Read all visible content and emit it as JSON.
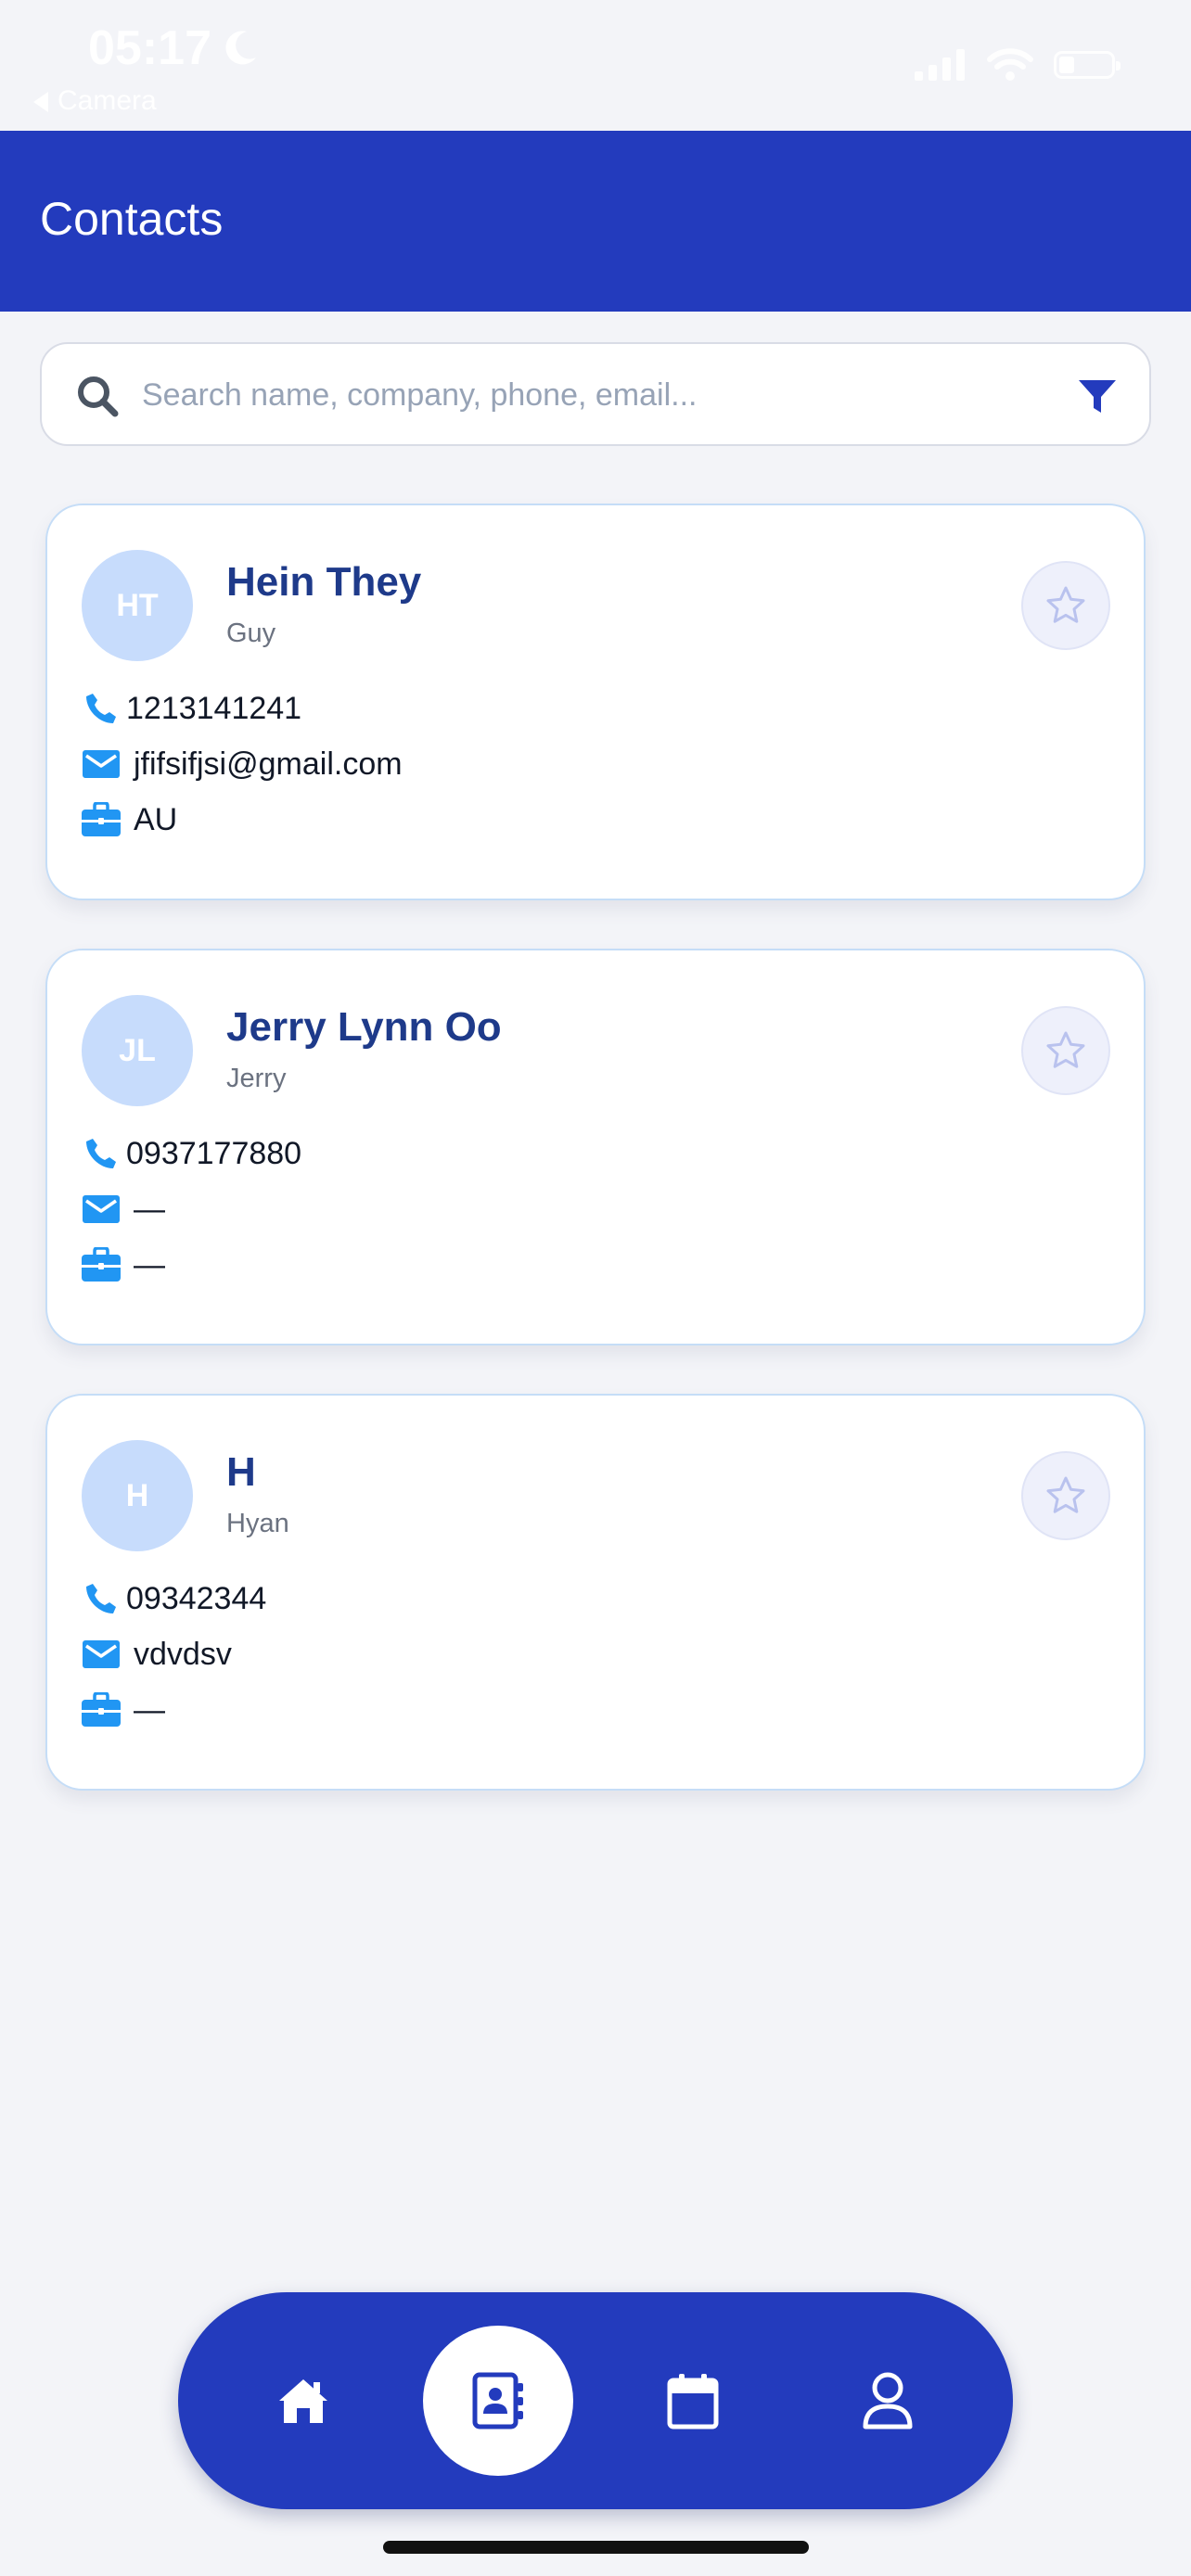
{
  "status_bar": {
    "time": "05:17",
    "back_label": "Camera"
  },
  "header": {
    "title": "Contacts"
  },
  "search": {
    "placeholder": "Search name, company, phone, email..."
  },
  "contacts": [
    {
      "initials": "HT",
      "name": "Hein They",
      "subtitle": "Guy",
      "phone": "1213141241",
      "email": "jfifsifjsi@gmail.com",
      "company": "AU",
      "favorite": false
    },
    {
      "initials": "JL",
      "name": "Jerry Lynn Oo",
      "subtitle": "Jerry",
      "phone": "0937177880",
      "email": "—",
      "company": "—",
      "favorite": false
    },
    {
      "initials": "H",
      "name": "H",
      "subtitle": "Hyan",
      "phone": "09342344",
      "email": "vdvdsv",
      "company": "—",
      "favorite": false
    }
  ],
  "bottom_nav": {
    "active": "contacts",
    "items": [
      {
        "id": "home",
        "icon": "home-icon"
      },
      {
        "id": "contacts",
        "icon": "contact-book-icon"
      },
      {
        "id": "calendar",
        "icon": "calendar-icon"
      },
      {
        "id": "profile",
        "icon": "user-icon"
      }
    ]
  },
  "colors": {
    "primary": "#233bbd",
    "accent": "#2196f3",
    "background": "#f3f4f8",
    "card_border": "#c5ddf7",
    "avatar": "#c7dcfc",
    "name_text": "#1e3a8a"
  }
}
